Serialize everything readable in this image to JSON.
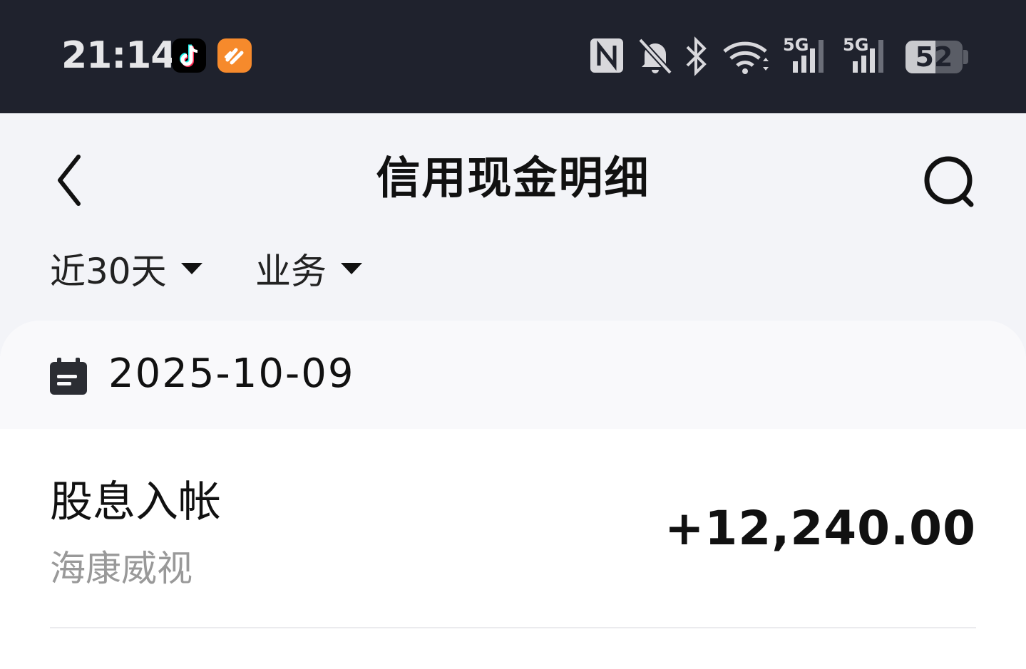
{
  "status_bar": {
    "time": "21:14",
    "apps": [
      "tiktok-icon",
      "hellobike-icon"
    ],
    "icons": [
      "nfc-icon",
      "mute-icon",
      "bluetooth-icon",
      "wifi-icon",
      "signal-5g-icon",
      "signal-5g-icon"
    ],
    "network_label_1": "5G",
    "network_label_2": "5G",
    "battery_level": "52",
    "battery_fraction": 0.52
  },
  "header": {
    "title": "信用现金明细",
    "back_icon": "chevron-left-icon",
    "search_icon": "search-icon"
  },
  "filters": {
    "range_label": "近30天",
    "business_label": "业务"
  },
  "records": {
    "date": "2025-10-09",
    "items": [
      {
        "type": "股息入帐",
        "name": "海康威视",
        "amount": "+12,240.00"
      }
    ]
  },
  "colors": {
    "status_bar_bg": "#1f222d",
    "page_bg": "#f3f4f8",
    "secondary_text": "#999999"
  }
}
